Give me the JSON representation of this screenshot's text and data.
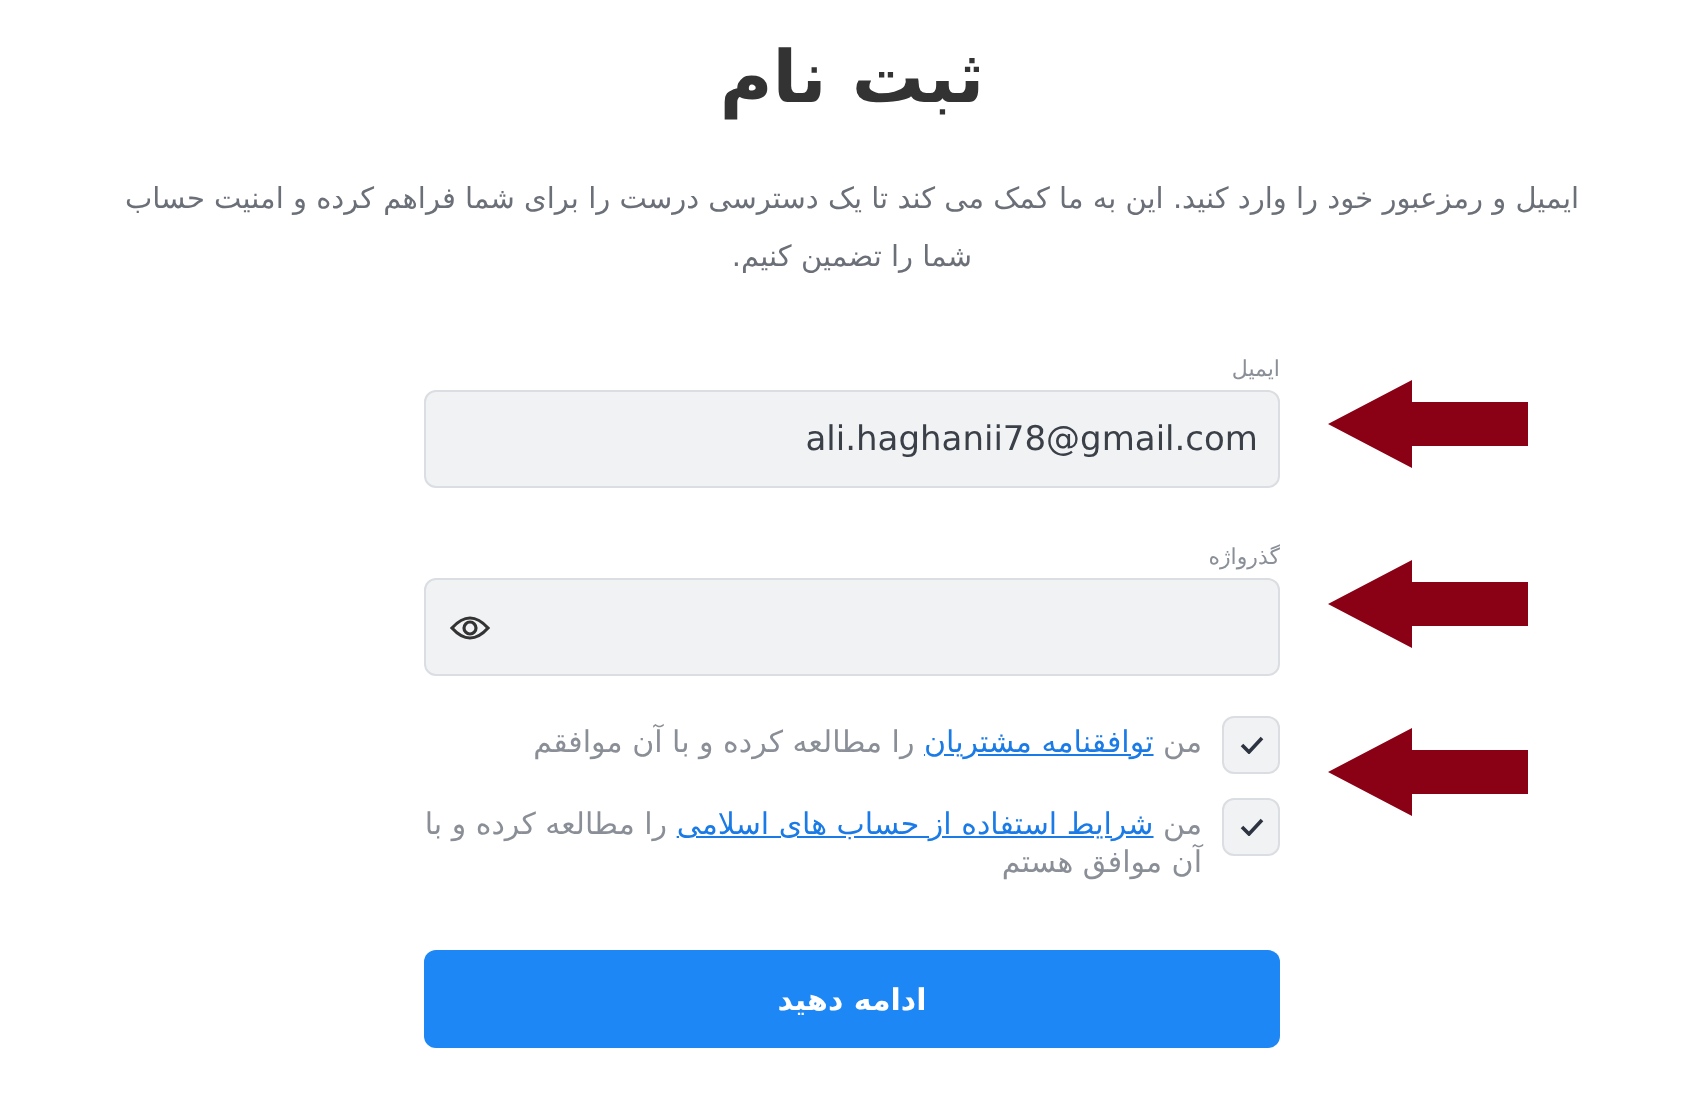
{
  "title": "ثبت نام",
  "description": "ایمیل و رمزعبور خود را وارد کنید. این به ما کمک می کند تا یک دسترسی درست را برای شما فراهم کرده و امنیت حساب شما را تضمین کنیم.",
  "fields": [
    {
      "label": "ایمیل",
      "value": "ali.haghanii78@gmail.com",
      "kind": "text"
    },
    {
      "label": "گذرواژه",
      "kind": "password"
    }
  ],
  "agreements": [
    {
      "checked": true,
      "parts": [
        {
          "kind": "text",
          "text": "من "
        },
        {
          "kind": "link",
          "text": "توافقنامه مشتریان"
        },
        {
          "kind": "text",
          "text": " را مطالعه کرده و با آن موافقم"
        }
      ]
    },
    {
      "checked": true,
      "parts": [
        {
          "kind": "text",
          "text": "من "
        },
        {
          "kind": "link",
          "text": "شرایط استفاده از حساب های اسلامی"
        },
        {
          "kind": "text",
          "text": " را مطالعه کرده و با آن موافق هستم"
        }
      ]
    }
  ],
  "submit": "ادامه دهید"
}
